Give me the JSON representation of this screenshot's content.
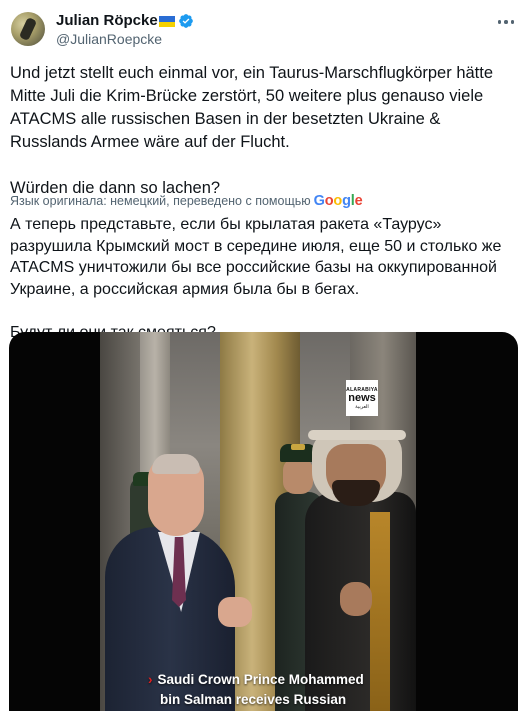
{
  "author": {
    "display_name": "Julian Röpcke",
    "handle": "@JulianRoepcke",
    "flag": "ukraine-flag",
    "verified": true
  },
  "menu": {
    "icon": "more-horizontal-icon"
  },
  "tweet": {
    "original_text": "Und jetzt stellt euch einmal vor, ein Taurus-Marschflugkörper hätte Mitte Juli die Krim-Brücke zerstört, 50 weitere plus genauso viele ATACMS alle russischen Basen in der besetzten Ukraine & Russlands Armee wäre auf der Flucht.\n\nWürden die dann so lachen?",
    "translated_by": "Язык оригинала: немецкий, переведено с помощью",
    "translator_brand": "Google",
    "translation_text": "А теперь представьте, если бы крылатая ракета «Таурус» разрушила Крымский мост в середине июля, еще 50 и столько же ATACMS уничтожили бы все российские базы на оккупированной Украине, а российская армия была бы в бегах.\n\nБудут ли они так смеяться?"
  },
  "media": {
    "watermark": {
      "top": "ALARABIYA",
      "main": "news",
      "bottom": "العربية"
    },
    "caption_line1": "Saudi Crown Prince Mohammed",
    "caption_line2": "bin Salman receives Russian",
    "caption_marker": "›"
  },
  "colors": {
    "text": "#0f1419",
    "secondary": "#536471",
    "verified_blue": "#1d9bf0",
    "google": [
      "#4285F4",
      "#EA4335",
      "#FBBC05",
      "#4285F4",
      "#34A853",
      "#EA4335"
    ]
  }
}
